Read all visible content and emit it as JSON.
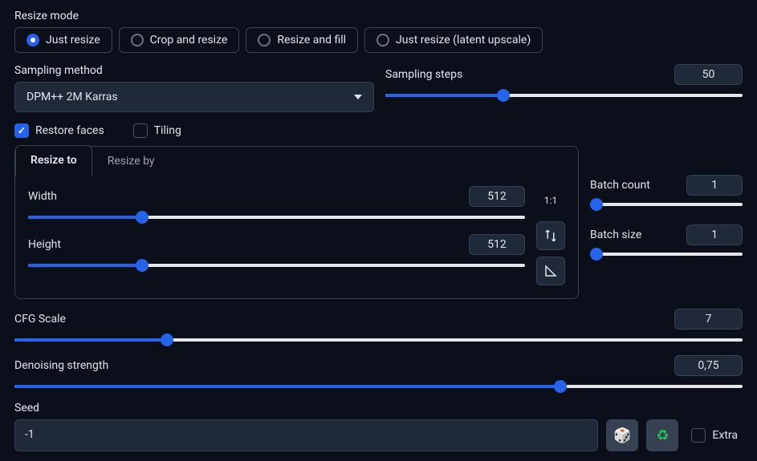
{
  "resize_mode": {
    "label": "Resize mode",
    "options": [
      "Just resize",
      "Crop and resize",
      "Resize and fill",
      "Just resize (latent upscale)"
    ],
    "selected": 0
  },
  "sampling_method": {
    "label": "Sampling method",
    "value": "DPM++ 2M Karras"
  },
  "sampling_steps": {
    "label": "Sampling steps",
    "value": 50,
    "min": 1,
    "max": 150
  },
  "restore_faces": {
    "label": "Restore faces",
    "checked": true
  },
  "tiling": {
    "label": "Tiling",
    "checked": false
  },
  "resize_tabs": {
    "active": "Resize to",
    "other": "Resize by"
  },
  "width": {
    "label": "Width",
    "value": 512,
    "min": 64,
    "max": 2048
  },
  "height": {
    "label": "Height",
    "value": 512,
    "min": 64,
    "max": 2048
  },
  "aspect_label": "1:1",
  "batch_count": {
    "label": "Batch count",
    "value": 1,
    "min": 1,
    "max": 100
  },
  "batch_size": {
    "label": "Batch size",
    "value": 1,
    "min": 1,
    "max": 8
  },
  "cfg_scale": {
    "label": "CFG Scale",
    "value": 7,
    "min": 1,
    "max": 30
  },
  "denoise": {
    "label": "Denoising strength",
    "value": "0,75",
    "frac": 0.75
  },
  "seed": {
    "label": "Seed",
    "value": "-1"
  },
  "extra": {
    "label": "Extra",
    "checked": false
  },
  "icons": {
    "dice": "🎲",
    "recycle": "♻"
  }
}
